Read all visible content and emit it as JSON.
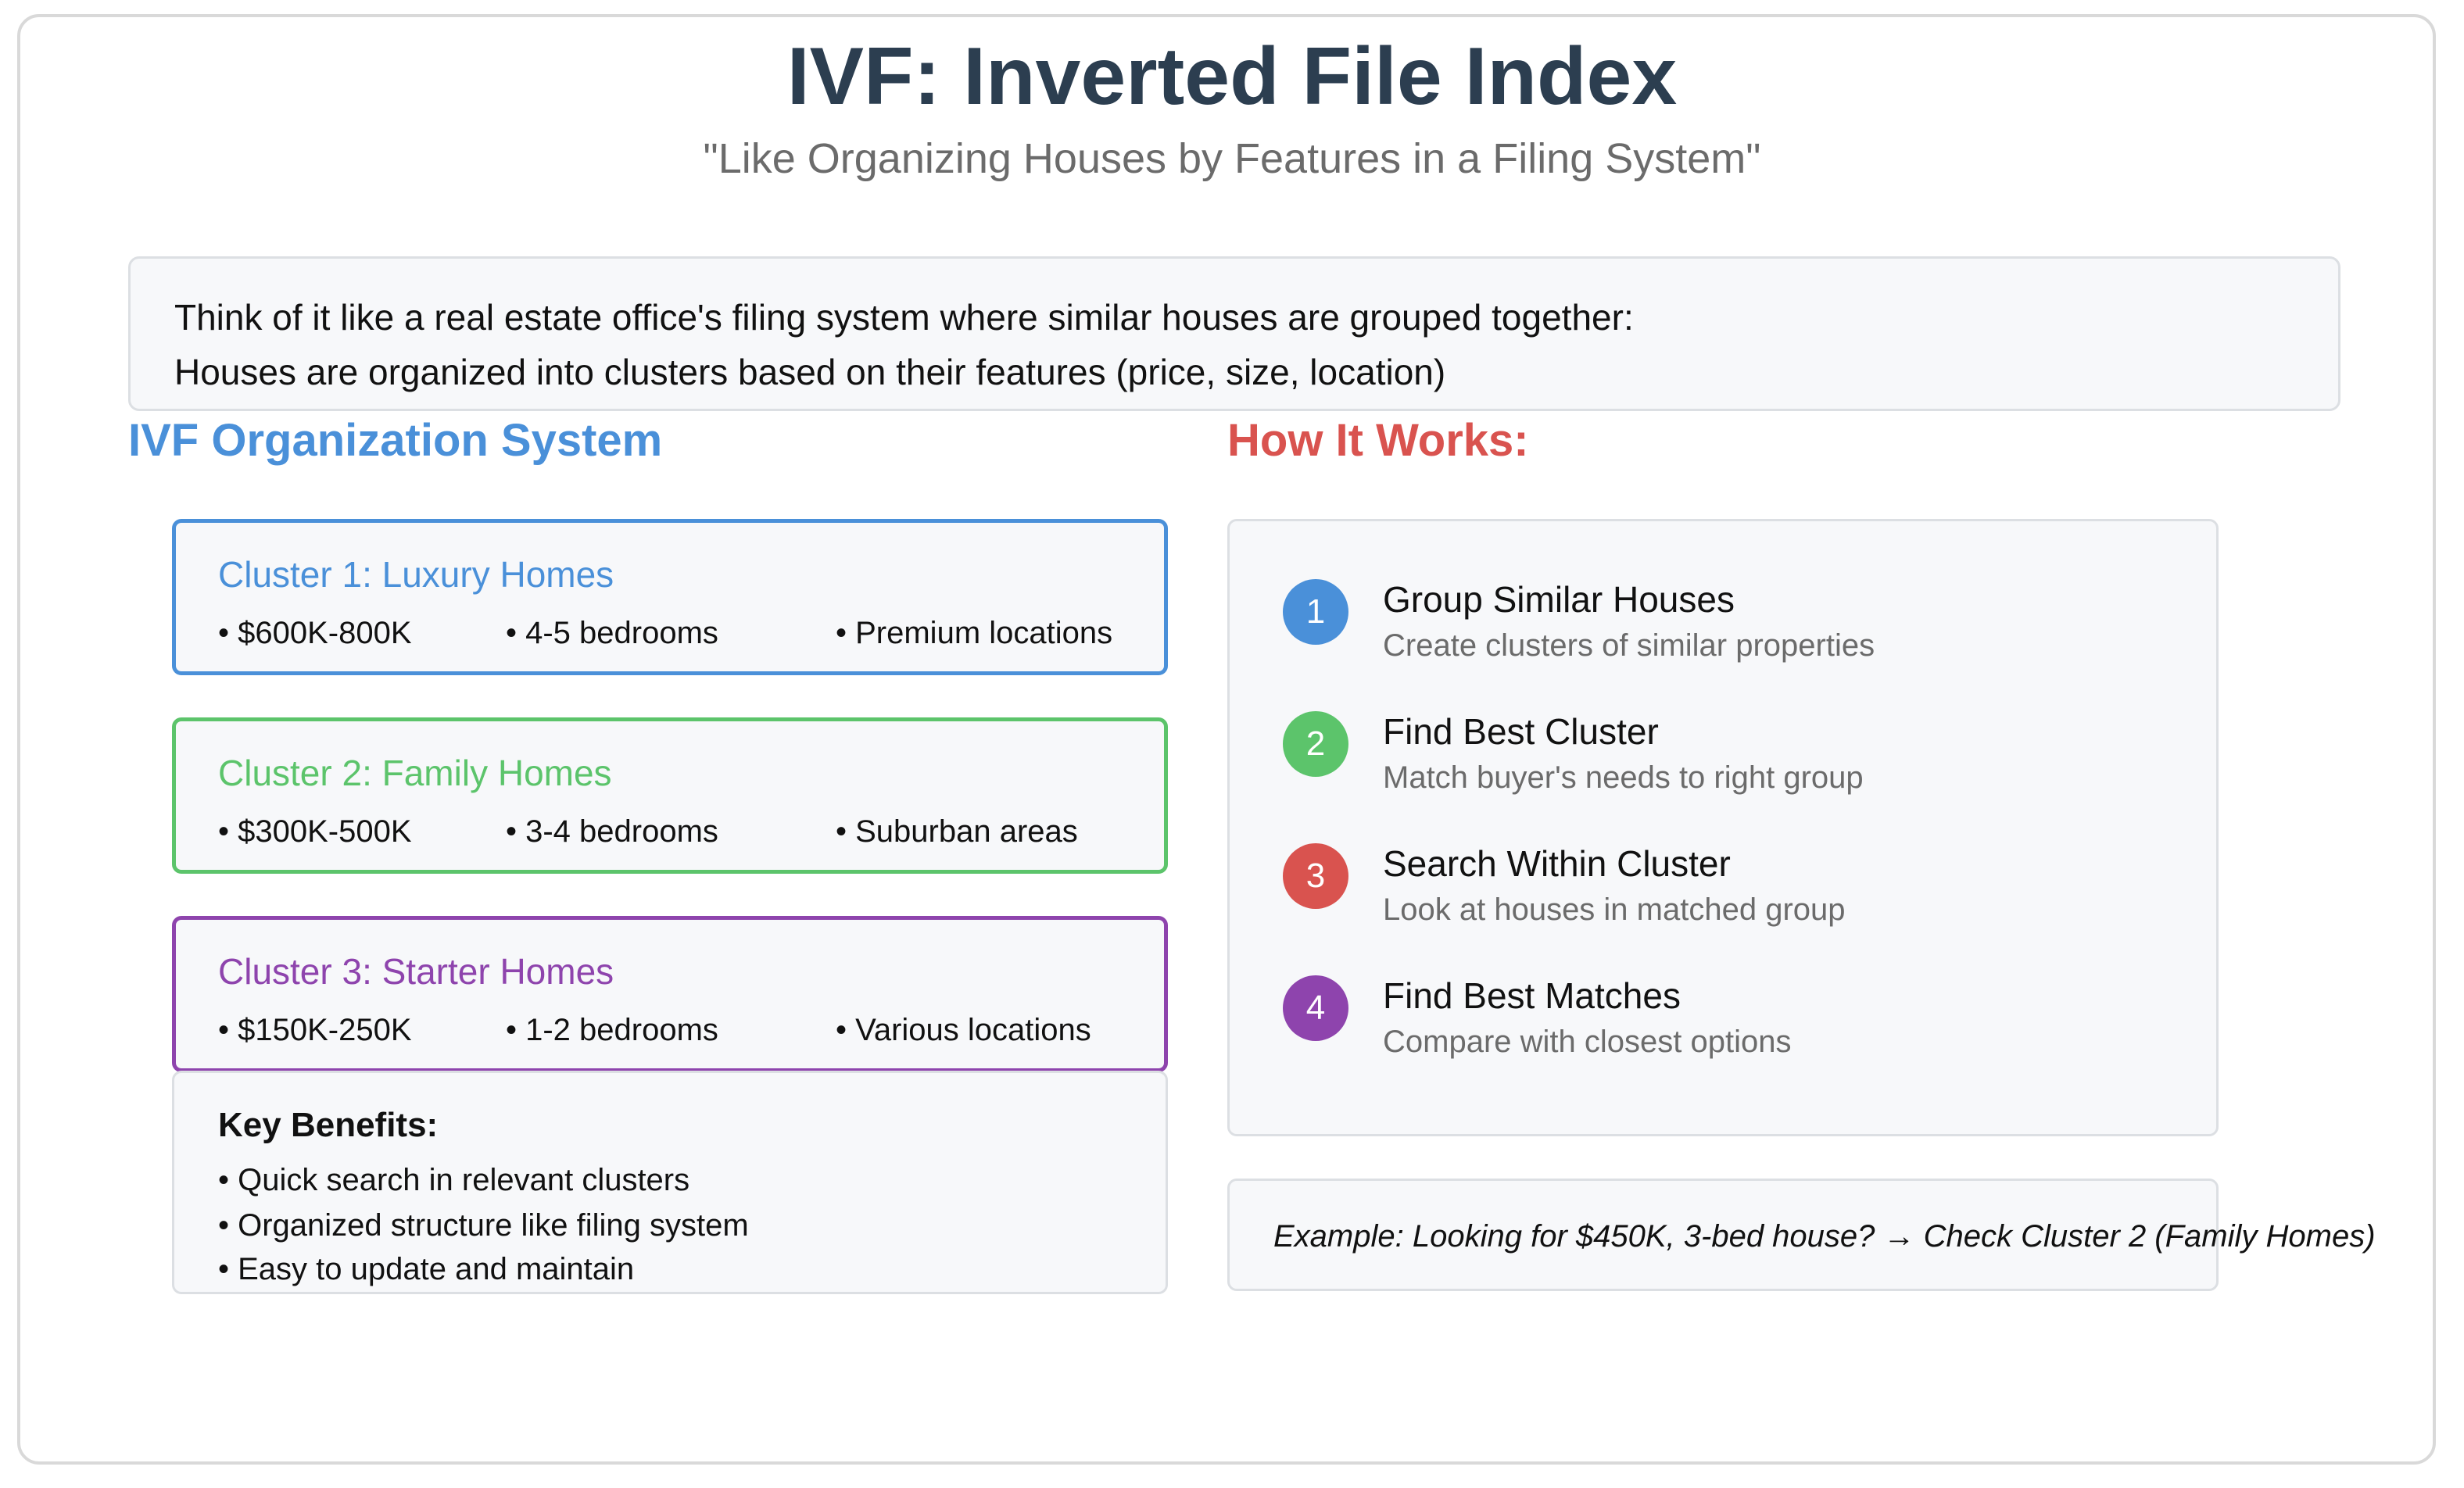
{
  "title": "IVF: Inverted File Index",
  "subtitle": "\"Like Organizing Houses by Features in a Filing System\"",
  "intro": {
    "line1": "Think of it like a real estate office's filing system where similar houses are grouped together:",
    "line2": "Houses are organized into clusters based on their features (price, size, location)"
  },
  "left_section": {
    "heading": "IVF Organization System",
    "clusters": [
      {
        "name": "Cluster 1: Luxury Homes",
        "color": "#4a90d9",
        "features": [
          "• $600K-800K",
          "• 4-5 bedrooms",
          "• Premium locations"
        ]
      },
      {
        "name": "Cluster 2: Family Homes",
        "color": "#5cc46b",
        "features": [
          "• $300K-500K",
          "• 3-4 bedrooms",
          "• Suburban areas"
        ]
      },
      {
        "name": "Cluster 3: Starter Homes",
        "color": "#8e44ad",
        "features": [
          "• $150K-250K",
          "• 1-2 bedrooms",
          "• Various locations"
        ]
      }
    ],
    "benefits": {
      "title": "Key Benefits:",
      "items": [
        "• Quick search in relevant clusters",
        "• Organized structure like filing system",
        "• Easy to update and maintain"
      ]
    }
  },
  "right_section": {
    "heading": "How It Works:",
    "steps": [
      {
        "number": "1",
        "title": "Group Similar Houses",
        "desc": "Create clusters of similar properties",
        "color": "#4a90d9"
      },
      {
        "number": "2",
        "title": "Find Best Cluster",
        "desc": "Match buyer's needs to right group",
        "color": "#5cc46b"
      },
      {
        "number": "3",
        "title": "Search Within Cluster",
        "desc": "Look at houses in matched group",
        "color": "#d9534f"
      },
      {
        "number": "4",
        "title": "Find Best Matches",
        "desc": "Compare with closest options",
        "color": "#8e44ad"
      }
    ],
    "example": "Example: Looking for $450K, 3-bed house? → Check Cluster 2 (Family Homes)"
  }
}
